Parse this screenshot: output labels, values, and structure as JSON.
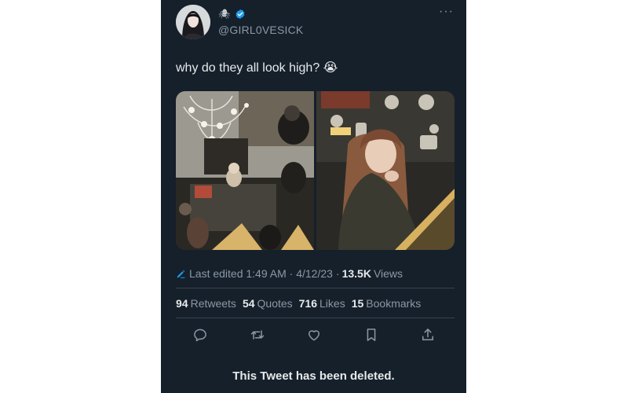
{
  "tweet": {
    "name_emoji": "🕷",
    "handle": "@GIRL0VESICK",
    "more_label": "···",
    "text": "why do they all look high? 😭",
    "edited_label": "Last edited 1:49 AM · 4/12/23",
    "views_sep": "·",
    "views_count": "13.5K",
    "views_label": "Views",
    "stats": {
      "retweets_count": "94",
      "retweets_label": "Retweets",
      "quotes_count": "54",
      "quotes_label": "Quotes",
      "likes_count": "716",
      "likes_label": "Likes",
      "bookmarks_count": "15",
      "bookmarks_label": "Bookmarks"
    },
    "icons": [
      "reply-icon",
      "retweet-icon",
      "like-icon",
      "bookmark-icon",
      "share-icon"
    ],
    "deleted_notice": "This Tweet has been deleted."
  },
  "colors": {
    "background": "#15202b",
    "text": "#e7e9ea",
    "muted": "#8b98a5",
    "accent": "#1d9bf0",
    "divider": "#38444d"
  }
}
